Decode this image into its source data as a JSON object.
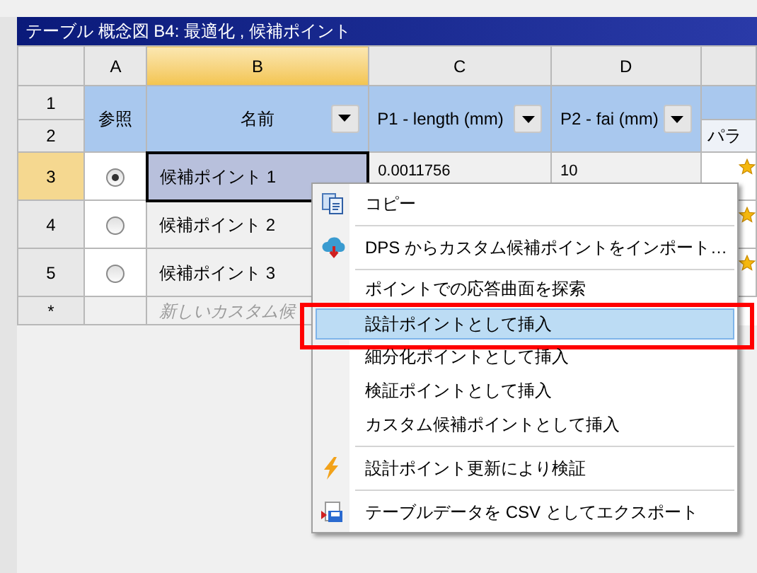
{
  "window": {
    "title": "テーブル 概念図 B4: 最適化 , 候補ポイント"
  },
  "table": {
    "column_letters": [
      {
        "label": "A",
        "selected": false
      },
      {
        "label": "B",
        "selected": true
      },
      {
        "label": "C",
        "selected": false
      },
      {
        "label": "D",
        "selected": false
      }
    ],
    "header_row_numbers": [
      "1",
      "2"
    ],
    "columns": [
      {
        "label": "参照",
        "dropdown": false
      },
      {
        "label": "名前",
        "dropdown": true
      },
      {
        "label": "P1 - length (mm)",
        "dropdown": true
      },
      {
        "label": "P2 - fai (mm)",
        "dropdown": true
      }
    ],
    "column_5_subheader": "パラ",
    "rows": [
      {
        "number": "3",
        "selected": true,
        "reference": true,
        "name": "候補ポイント 1",
        "p1": "0.0011756",
        "p2": "10"
      },
      {
        "number": "4",
        "selected": false,
        "reference": false,
        "name": "候補ポイント 2"
      },
      {
        "number": "5",
        "selected": false,
        "reference": false,
        "name": "候補ポイント 3"
      }
    ],
    "new_row": {
      "marker": "*",
      "placeholder": "新しいカスタム候"
    }
  },
  "context_menu": {
    "items": [
      {
        "kind": "copy",
        "label": "コピー",
        "selected": false
      },
      {
        "kind": "separator"
      },
      {
        "kind": "import",
        "label": "DPS からカスタム候補ポイントをインポート…",
        "selected": false
      },
      {
        "kind": "separator"
      },
      {
        "kind": "item",
        "label": "ポイントでの応答曲面を探索",
        "selected": false
      },
      {
        "kind": "item",
        "label": "設計ポイントとして挿入",
        "selected": true,
        "highlighted_frame": true
      },
      {
        "kind": "item",
        "label": "細分化ポイントとして挿入",
        "selected": false
      },
      {
        "kind": "item",
        "label": "検証ポイントとして挿入",
        "selected": false
      },
      {
        "kind": "item",
        "label": "カスタム候補ポイントとして挿入",
        "selected": false
      },
      {
        "kind": "separator"
      },
      {
        "kind": "verify",
        "label": "設計ポイント更新により検証",
        "selected": false
      },
      {
        "kind": "separator"
      },
      {
        "kind": "export",
        "label": "テーブルデータを CSV としてエクスポート",
        "selected": false
      }
    ]
  }
}
